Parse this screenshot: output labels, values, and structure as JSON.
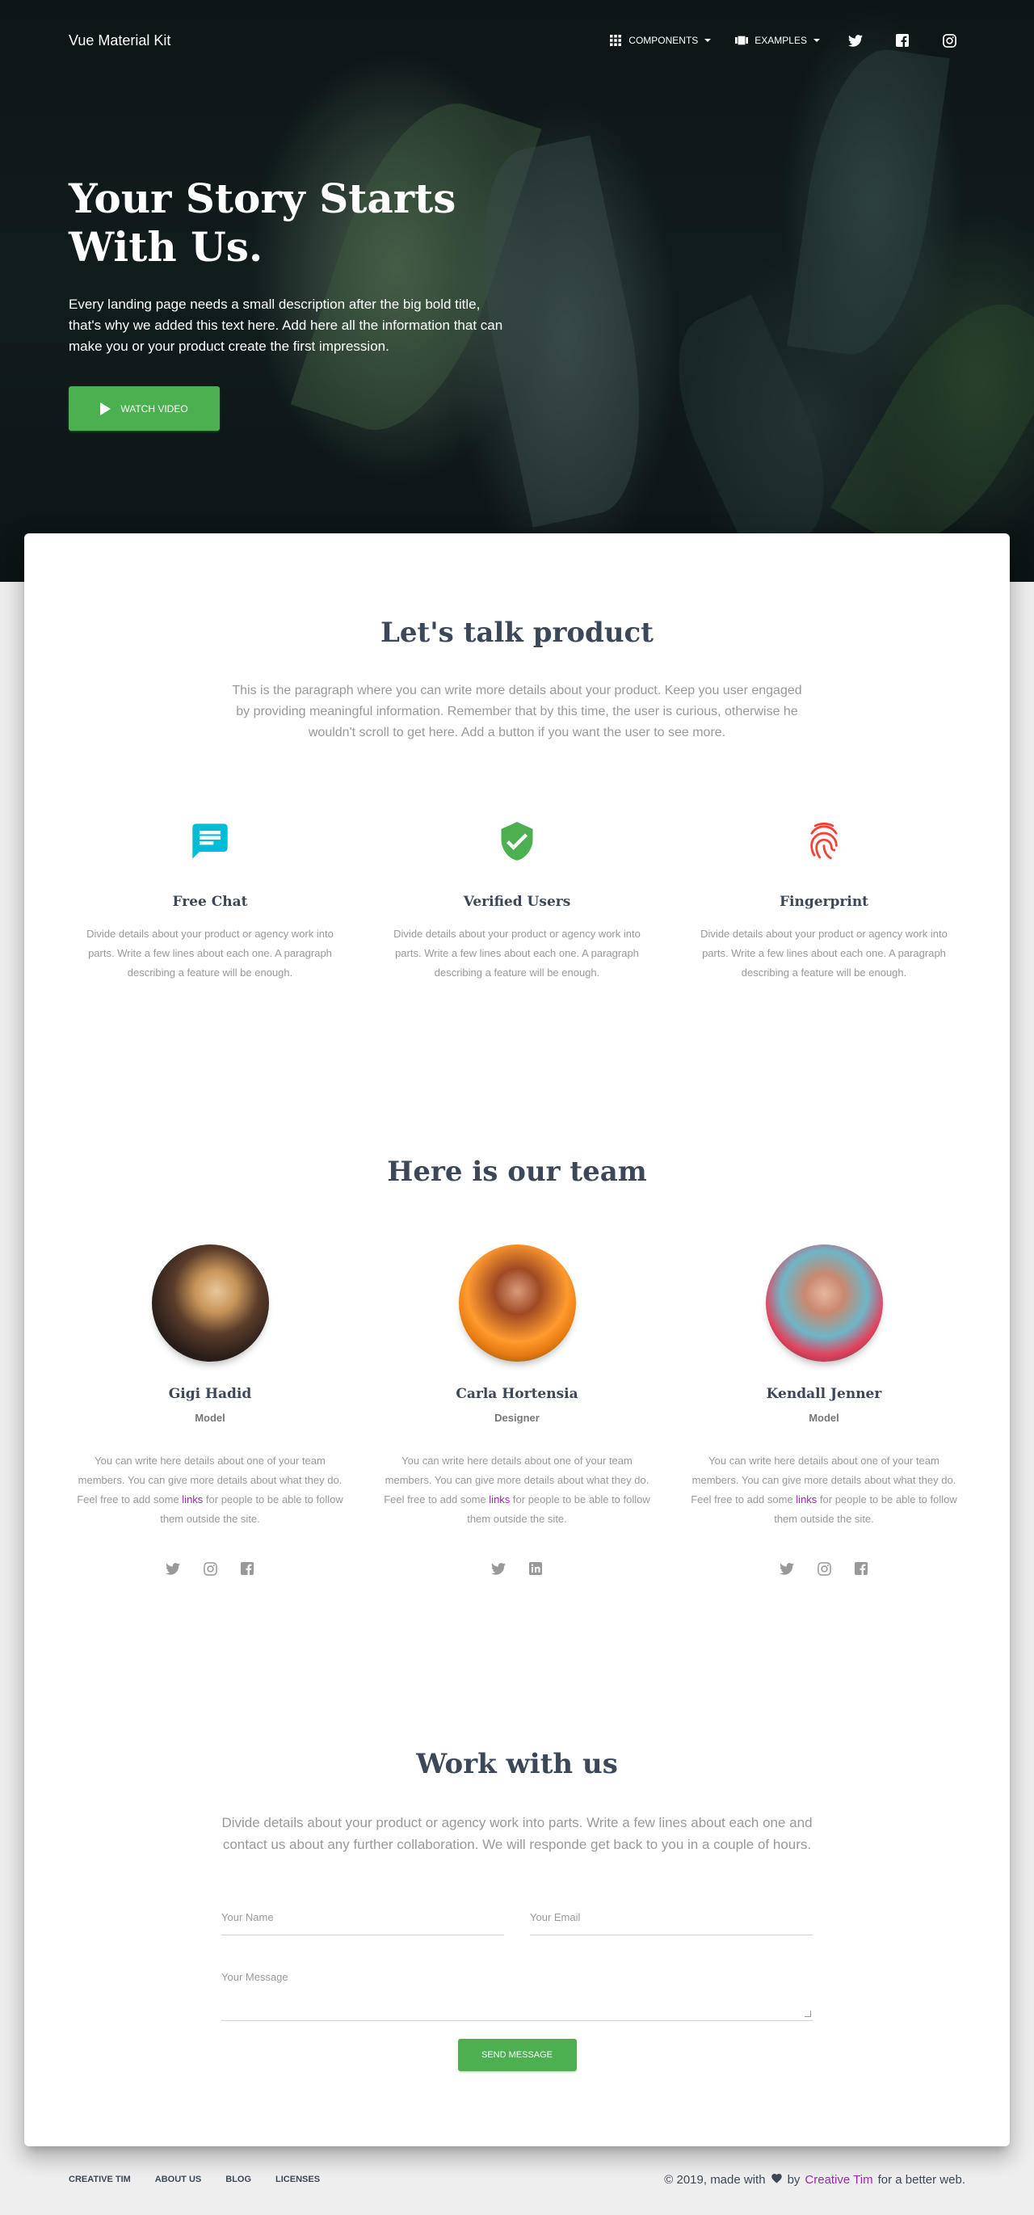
{
  "colors": {
    "accent_green": "#4caf50",
    "link_purple": "#9c27b0",
    "heading": "#3c4858",
    "muted": "#999999",
    "chat_blue": "#00bcd4",
    "fingerprint_red": "#f44336"
  },
  "navbar": {
    "brand": "Vue Material Kit",
    "components_label": "Components",
    "examples_label": "Examples",
    "components_icon": "apps-grid-icon",
    "examples_icon": "view-carousel-icon",
    "social_icons": [
      "twitter-icon",
      "facebook-icon",
      "instagram-icon"
    ]
  },
  "hero": {
    "title_line1": "Your Story Starts",
    "title_line2": "With Us.",
    "description": "Every landing page needs a small description after the big bold title, that's why we added this text here. Add here all the information that can make you or your product create the first impression.",
    "button_label": "Watch video"
  },
  "product": {
    "title": "Let's talk product",
    "description": "This is the paragraph where you can write more details about your product. Keep you user engaged by providing meaningful information. Remember that by this time, the user is curious, otherwise he wouldn't scroll to get here. Add a button if you want the user to see more.",
    "features": [
      {
        "icon": "chat-icon",
        "title": "Free Chat",
        "description": "Divide details about your product or agency work into parts. Write a few lines about each one. A paragraph describing a feature will be enough."
      },
      {
        "icon": "verified-shield-icon",
        "title": "Verified Users",
        "description": "Divide details about your product or agency work into parts. Write a few lines about each one. A paragraph describing a feature will be enough."
      },
      {
        "icon": "fingerprint-icon",
        "title": "Fingerprint",
        "description": "Divide details about your product or agency work into parts. Write a few lines about each one. A paragraph describing a feature will be enough."
      }
    ]
  },
  "team": {
    "title": "Here is our team",
    "desc_before": "You can write here details about one of your team members. You can give more details about what they do. Feel free to add some ",
    "desc_link": "links",
    "desc_after": " for people to be able to follow them outside the site.",
    "members": [
      {
        "name": "Gigi Hadid",
        "role": "Model",
        "socials": [
          "twitter-icon",
          "instagram-icon",
          "facebook-icon"
        ]
      },
      {
        "name": "Carla Hortensia",
        "role": "Designer",
        "socials": [
          "twitter-icon",
          "linkedin-icon"
        ]
      },
      {
        "name": "Kendall Jenner",
        "role": "Model",
        "socials": [
          "twitter-icon",
          "instagram-icon",
          "facebook-icon"
        ]
      }
    ]
  },
  "work": {
    "title": "Work with us",
    "description": "Divide details about your product or agency work into parts. Write a few lines about each one and contact us about any further collaboration. We will responde get back to you in a couple of hours.",
    "name_placeholder": "Your Name",
    "email_placeholder": "Your Email",
    "message_placeholder": "Your Message",
    "send_label": "Send Message"
  },
  "footer": {
    "links": [
      "Creative Tim",
      "About Us",
      "Blog",
      "Licenses"
    ],
    "copyright_before": "© 2019, made with",
    "copyright_by": "by",
    "copyright_link": "Creative Tim",
    "copyright_after": "for a better web."
  }
}
